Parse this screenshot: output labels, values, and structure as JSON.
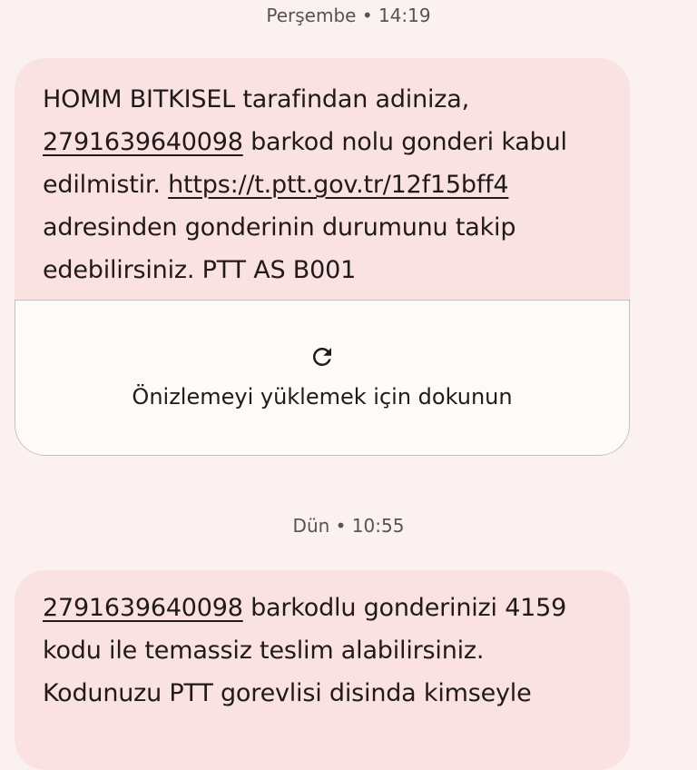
{
  "conversation": {
    "messages": [
      {
        "timestamp": "Perşembe • 14:19",
        "text": {
          "sender": "HOMM BITKISEL",
          "part1": " tarafindan adiniza,",
          "barcode": "2791639640098",
          "part2": " barkod nolu gonderi kabul edilmistir. ",
          "link": "https://t.ptt.gov.tr/12f15bff4",
          "part3": " adresinden gonderinin durumunu takip edebilirsiniz. PTT AS B001"
        },
        "preview": {
          "icon": "refresh-icon",
          "label": "Önizlemeyi yüklemek için dokunun"
        }
      },
      {
        "timestamp": "Dün • 10:55",
        "text": {
          "barcode": "2791639640098",
          "part1": " barkodlu gonderinizi 4159 kodu ile temassiz teslim alabilirsiniz. Kodunuzu PTT gorevlisi disinda kimseyle"
        }
      }
    ]
  },
  "colors": {
    "background": "#fcf1f1",
    "bubble": "#fbe2e2",
    "preview_card": "#fffafa",
    "text": "#201a1a",
    "timestamp": "#5a5151"
  }
}
